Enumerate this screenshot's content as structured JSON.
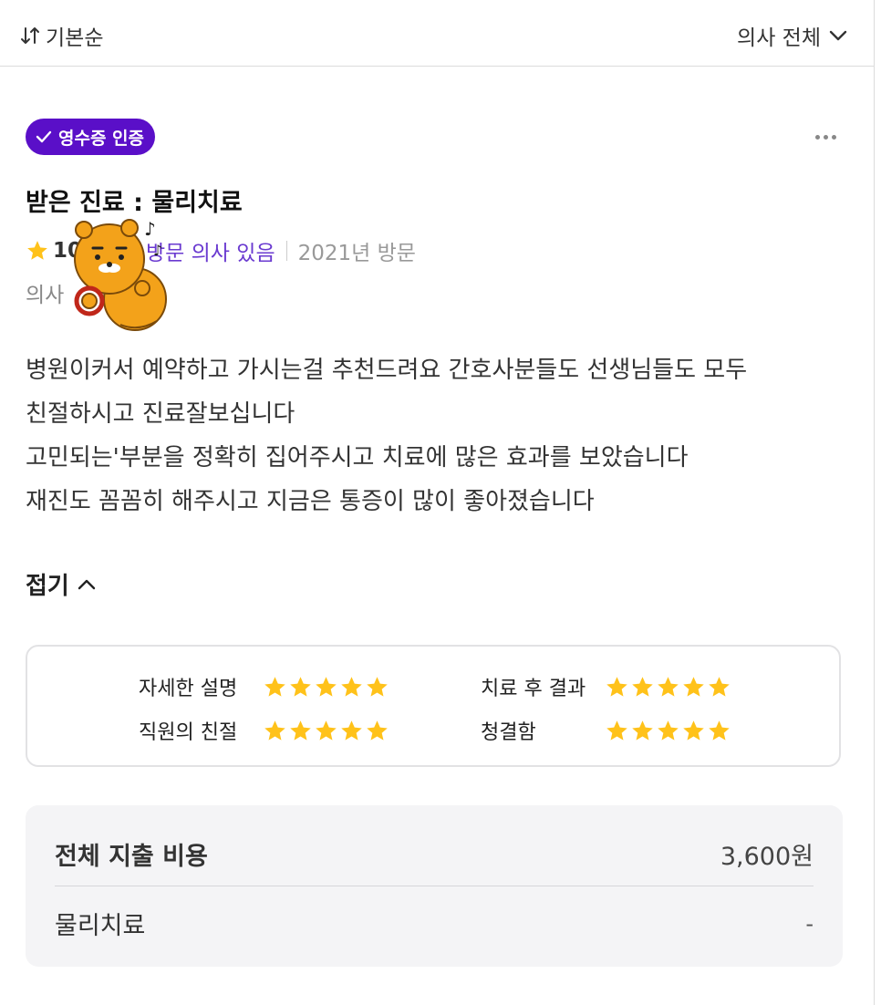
{
  "toolbar": {
    "sort_label": "기본순",
    "doctor_filter_label": "의사 전체"
  },
  "review": {
    "badge": "영수증 인증",
    "title": "받은 진료 :  물리치료",
    "rating": "10",
    "visit_doctor": "방문 의사 있음",
    "visit_year": "2021년 방문",
    "doctor_prefix": "의사",
    "body_lines": [
      "병원이커서 예약하고 가시는걸 추천드려요 간호사분들도 선생님들도 모두",
      "친절하시고 진료잘보십니다",
      "고민되는'부분을 정확히 집어주시고 치료에 많은 효과를 보았습니다",
      "재진도 꼼꼼히 해주시고 지금은 통증이 많이 좋아졌습니다"
    ],
    "fold_label": "접기"
  },
  "scores": [
    {
      "label": "자세한 설명",
      "stars": 5
    },
    {
      "label": "치료 후 결과",
      "stars": 5
    },
    {
      "label": "직원의 친절",
      "stars": 5
    },
    {
      "label": "청결함",
      "stars": 5
    }
  ],
  "cost": {
    "total_label": "전체 지출 비용",
    "total_value": "3,600원",
    "items": [
      {
        "label": "물리치료",
        "value": "-"
      }
    ]
  },
  "colors": {
    "accent": "#5a0fc8",
    "star": "#ffc21a",
    "visit_doctor": "#6a3ad0"
  }
}
